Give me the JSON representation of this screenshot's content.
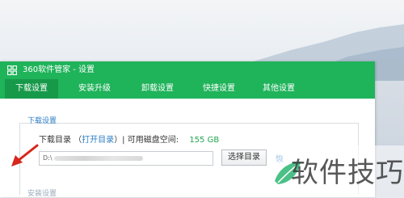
{
  "window": {
    "title": "360软件管家 - 设置",
    "accent_color": "#1fb35a",
    "active_tab_color": "#17994a",
    "icon": "grid-icon"
  },
  "tabs": [
    {
      "label": "下载设置",
      "active": true
    },
    {
      "label": "安装升级",
      "active": false
    },
    {
      "label": "卸载设置",
      "active": false
    },
    {
      "label": "快捷设置",
      "active": false
    },
    {
      "label": "其他设置",
      "active": false
    }
  ],
  "download": {
    "section_title": "下载设置",
    "dir_label": "下载目录",
    "open_dir_link": "打开目录",
    "space_label": "可用磁盘空间:",
    "space_value": "155 GB",
    "path_value": "D:\\",
    "choose_button": "选择目录",
    "extra_link": "恢"
  },
  "next_section_title": "安装设置",
  "watermark": {
    "text": "软件技巧",
    "icon": "leaf-logo-icon"
  }
}
